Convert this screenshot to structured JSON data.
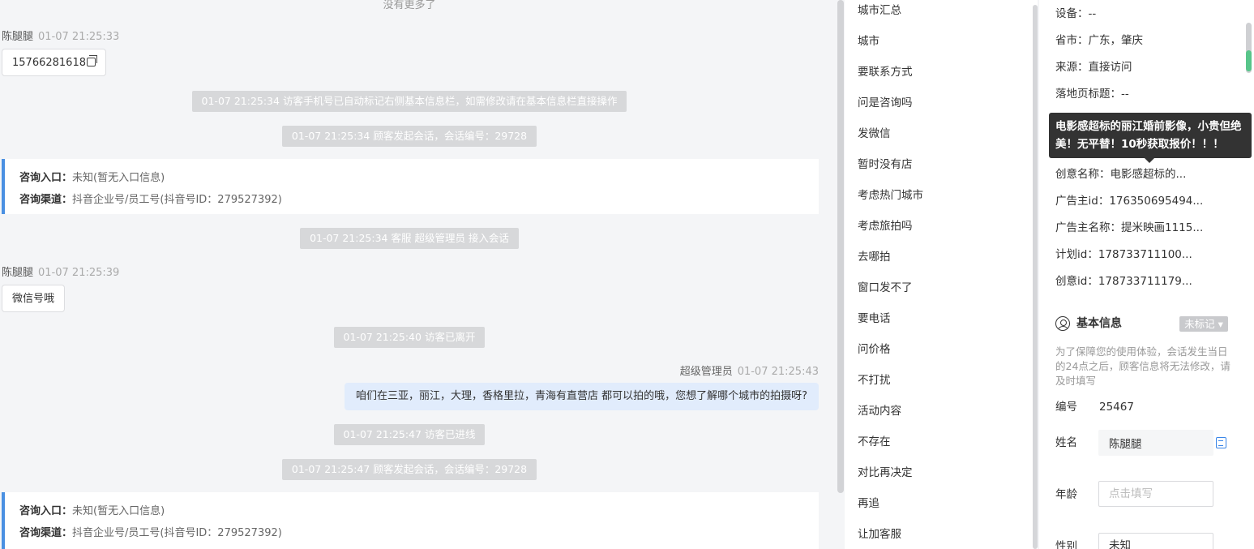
{
  "chat": {
    "no_more": "没有更多了",
    "visitor_name": "陈腿腿",
    "agent_name": "超级管理员",
    "msg1_time": "01-07 21:25:33",
    "msg1_text": "15766281618",
    "sys1": "01-07 21:25:34 访客手机号已自动标记右侧基本信息栏，如需修改请在基本信息栏直接操作",
    "sys2": "01-07 21:25:34 顾客发起会话，会话编号：29728",
    "card1": {
      "entry_label": "咨询入口：",
      "entry_value": "未知(暂无入口信息)",
      "channel_label": "咨询渠道：",
      "channel_value": "抖音企业号/员工号(抖音号ID：279527392)"
    },
    "sys3": "01-07 21:25:34 客服 超级管理员 接入会话",
    "msg2_time": "01-07 21:25:39",
    "msg2_text": "微信号哦",
    "sys4": "01-07 21:25:40 访客已离开",
    "agent_time": "01-07 21:25:43",
    "agent_text": "咱们在三亚，丽江，大理，香格里拉，青海有直营店 都可以拍的哦，您想了解哪个城市的拍摄呀?",
    "sys5": "01-07 21:25:47 访客已进线",
    "sys6": "01-07 21:25:47 顾客发起会话，会话编号：29728",
    "card2": {
      "entry_label": "咨询入口：",
      "entry_value": "未知(暂无入口信息)",
      "channel_label": "咨询渠道：",
      "channel_value": "抖音企业号/员工号(抖音号ID：279527392)"
    }
  },
  "quick_replies": [
    "城市汇总",
    "城市",
    "要联系方式",
    "问是咨询吗",
    "发微信",
    "暂时没有店",
    "考虑热门城市",
    "考虑旅拍吗",
    "去哪拍",
    "窗口发不了",
    "要电话",
    "问价格",
    "不打扰",
    "活动内容",
    "不存在",
    "对比再决定",
    "再追",
    "让加客服"
  ],
  "info": {
    "device": "设备：--",
    "province": "省市：广东，肇庆",
    "source": "来源：直接访问",
    "landing_title": "落地页标题：--",
    "tooltip": "电影感超标的丽江婚前影像，小贵但绝美！无平替！10秒获取报价！！！",
    "creative_name": "创意名称：电影感超标的...",
    "advertiser_id": "广告主id：176350695494...",
    "advertiser_name": "广告主名称：提米映画1115...",
    "plan_id": "计划id：178733711100...",
    "creative_id": "创意id：178733711179...",
    "section_title": "基本信息",
    "tag_label": "未标记",
    "note": "为了保障您的使用体验，会话发生当日的24点之后，顾客信息将无法修改，请及时填写",
    "number_label": "编号",
    "number_value": "25467",
    "name_label": "姓名",
    "name_value": "陈腿腿",
    "age_label": "年龄",
    "age_placeholder": "点击填写",
    "gender_label": "性别",
    "gender_value": "未知"
  }
}
